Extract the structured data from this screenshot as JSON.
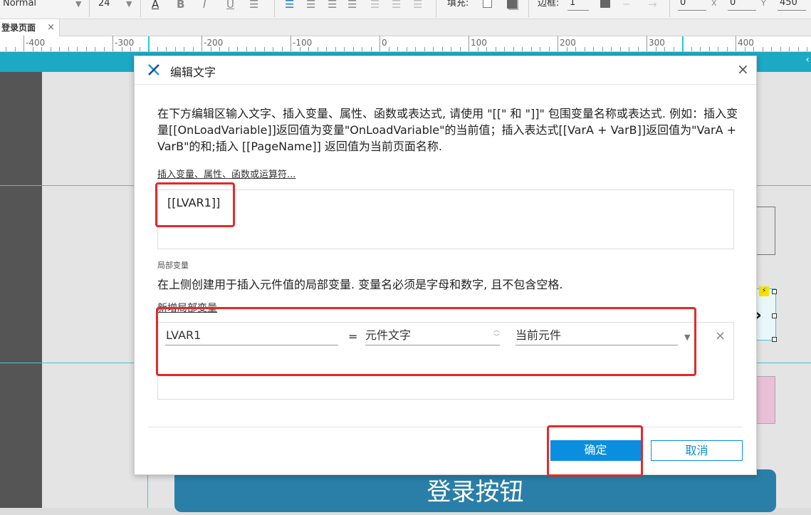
{
  "toolbar": {
    "font_style": "Normal",
    "font_size": "24",
    "fill_label": "填充:",
    "border_label": "边框:",
    "border_value": "1",
    "x_value": "0",
    "x_label": "X",
    "y_value": "0",
    "y_label": "Y",
    "w_value": "450"
  },
  "tab": {
    "label": "登录页面",
    "close": "×"
  },
  "ruler": {
    "labels": [
      "-400",
      "-300",
      "-200",
      "-100",
      "0",
      "100",
      "200",
      "300",
      "400"
    ]
  },
  "canvas": {
    "login_button": "登录按钮"
  },
  "dialog": {
    "title": "编辑文字",
    "close": "×",
    "instructions": "在下方编辑区输入文字、插入变量、属性、函数或表达式, 请使用 \"[[\" 和 \"]]\" 包围变量名称或表达式. 例如：插入变量[[OnLoadVariable]]返回值为变量\"OnLoadVariable\"的当前值；插入表达式[[VarA + VarB]]返回值为\"VarA + VarB\"的和;插入 [[PageName]] 返回值为当前页面名称.",
    "insert_link": "插入变量、属性、函数或运算符...",
    "editor_text": "[[LVAR1]]",
    "local_vars_heading": "局部变量",
    "local_vars_desc": "在上侧创建用于插入元件值的局部变量. 变量名必须是字母和数字, 且不包含空格.",
    "add_local_var": "新增局部变量",
    "variable": {
      "name": "LVAR1",
      "equals": "=",
      "type": "元件文字",
      "target": "当前元件"
    },
    "ok": "确定",
    "cancel": "取消"
  },
  "colors": {
    "accent": "#0a8ee0",
    "highlight": "#e32a2a",
    "canvas_bar": "#1ba9c4",
    "guide": "#3cc8d4"
  }
}
